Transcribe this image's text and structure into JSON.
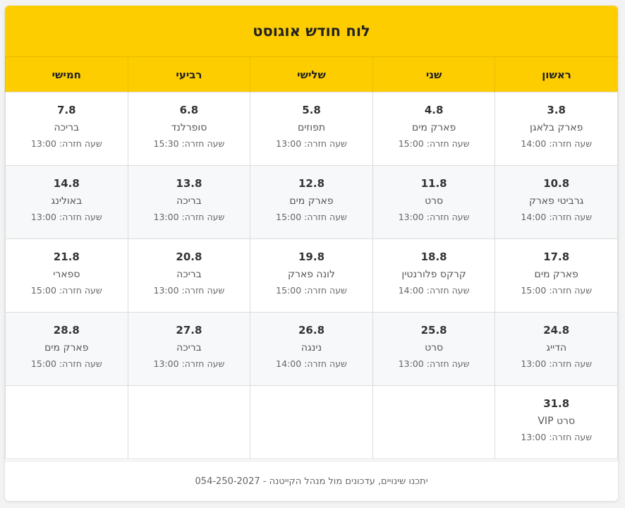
{
  "title": "לוח חודש אוגוסט",
  "days": [
    "ראשון",
    "שני",
    "שלישי",
    "רביעי",
    "חמישי"
  ],
  "return_prefix": "שעה חזרה:",
  "weeks": [
    [
      {
        "date": "3.8",
        "activity": "פארק בלאגן",
        "return": "14:00"
      },
      {
        "date": "4.8",
        "activity": "פארק מים",
        "return": "15:00"
      },
      {
        "date": "5.8",
        "activity": "תפוזים",
        "return": "13:00"
      },
      {
        "date": "6.8",
        "activity": "סופרלנד",
        "return": "15:30"
      },
      {
        "date": "7.8",
        "activity": "בריכה",
        "return": "13:00"
      }
    ],
    [
      {
        "date": "10.8",
        "activity": "גרביטי פארק",
        "return": "14:00"
      },
      {
        "date": "11.8",
        "activity": "סרט",
        "return": "13:00"
      },
      {
        "date": "12.8",
        "activity": "פארק מים",
        "return": "15:00"
      },
      {
        "date": "13.8",
        "activity": "בריכה",
        "return": "13:00"
      },
      {
        "date": "14.8",
        "activity": "באולינג",
        "return": "13:00"
      }
    ],
    [
      {
        "date": "17.8",
        "activity": "פארק מים",
        "return": "15:00"
      },
      {
        "date": "18.8",
        "activity": "קרקס פלורנטין",
        "return": "14:00"
      },
      {
        "date": "19.8",
        "activity": "לונה פארק",
        "return": "15:00"
      },
      {
        "date": "20.8",
        "activity": "בריכה",
        "return": "13:00"
      },
      {
        "date": "21.8",
        "activity": "ספארי",
        "return": "15:00"
      }
    ],
    [
      {
        "date": "24.8",
        "activity": "הדייג",
        "return": "13:00"
      },
      {
        "date": "25.8",
        "activity": "סרט",
        "return": "13:00"
      },
      {
        "date": "26.8",
        "activity": "נינגה",
        "return": "14:00"
      },
      {
        "date": "27.8",
        "activity": "בריכה",
        "return": "13:00"
      },
      {
        "date": "28.8",
        "activity": "פארק מים",
        "return": "15:00"
      }
    ],
    [
      {
        "date": "31.8",
        "activity": "סרט VIP",
        "return": "13:00"
      },
      null,
      null,
      null,
      null
    ]
  ],
  "footer": "יתכנו שינויים, עדכונים מול מנהל הקייטנה - 054-250-2027"
}
